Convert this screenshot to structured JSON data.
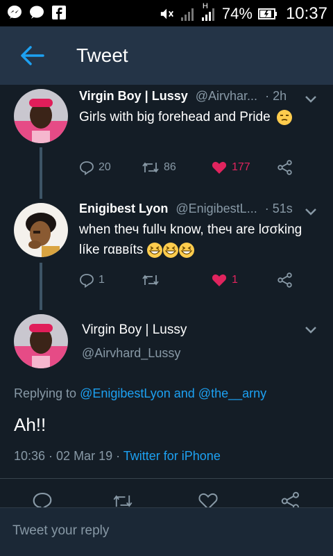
{
  "status_bar": {
    "battery_percent": "74%",
    "time": "10:37",
    "network_label": "H",
    "icons": [
      "messenger-icon",
      "chat-icon",
      "facebook-icon",
      "mute-icon",
      "signal-icon",
      "signal-icon",
      "battery-icon"
    ]
  },
  "header": {
    "title": "Tweet",
    "back_icon": "arrow-left-icon"
  },
  "tweets": [
    {
      "name": "Virgin Boy | Lussy",
      "handle": "@Airvhar...",
      "time": "· 2h",
      "text": "Girls with big forehead and Pride",
      "emoji": "unamused-face",
      "reply_count": "20",
      "retweet_count": "86",
      "like_count": "177",
      "liked": true
    },
    {
      "name": "Enigibest Lyon",
      "handle": "@EnigibestL...",
      "time": "· 51s",
      "text_line1": "when thеч fullч know, thеч are lσσking",
      "text_line2": "líkе rαввíts",
      "emoji": "grinning-squinting-face x3",
      "reply_count": "1",
      "retweet_count": "",
      "like_count": "1",
      "liked": true
    }
  ],
  "detail": {
    "name": "Virgin Boy | Lussy",
    "handle": "@Airvhard_Lussy",
    "replying_prefix": "Replying to ",
    "mention1": "@EnigibestLyon",
    "replying_and": " and ",
    "mention2": "@the__arny",
    "text": "Ah!!",
    "timestamp": "10:36 · 02 Mar 19 · ",
    "source": "Twitter for iPhone"
  },
  "reply_bar": {
    "placeholder": "Tweet your reply"
  },
  "colors": {
    "background": "#141d26",
    "header": "#243447",
    "accent": "#1da1f2",
    "like": "#e0245e",
    "muted": "#8899a6"
  }
}
